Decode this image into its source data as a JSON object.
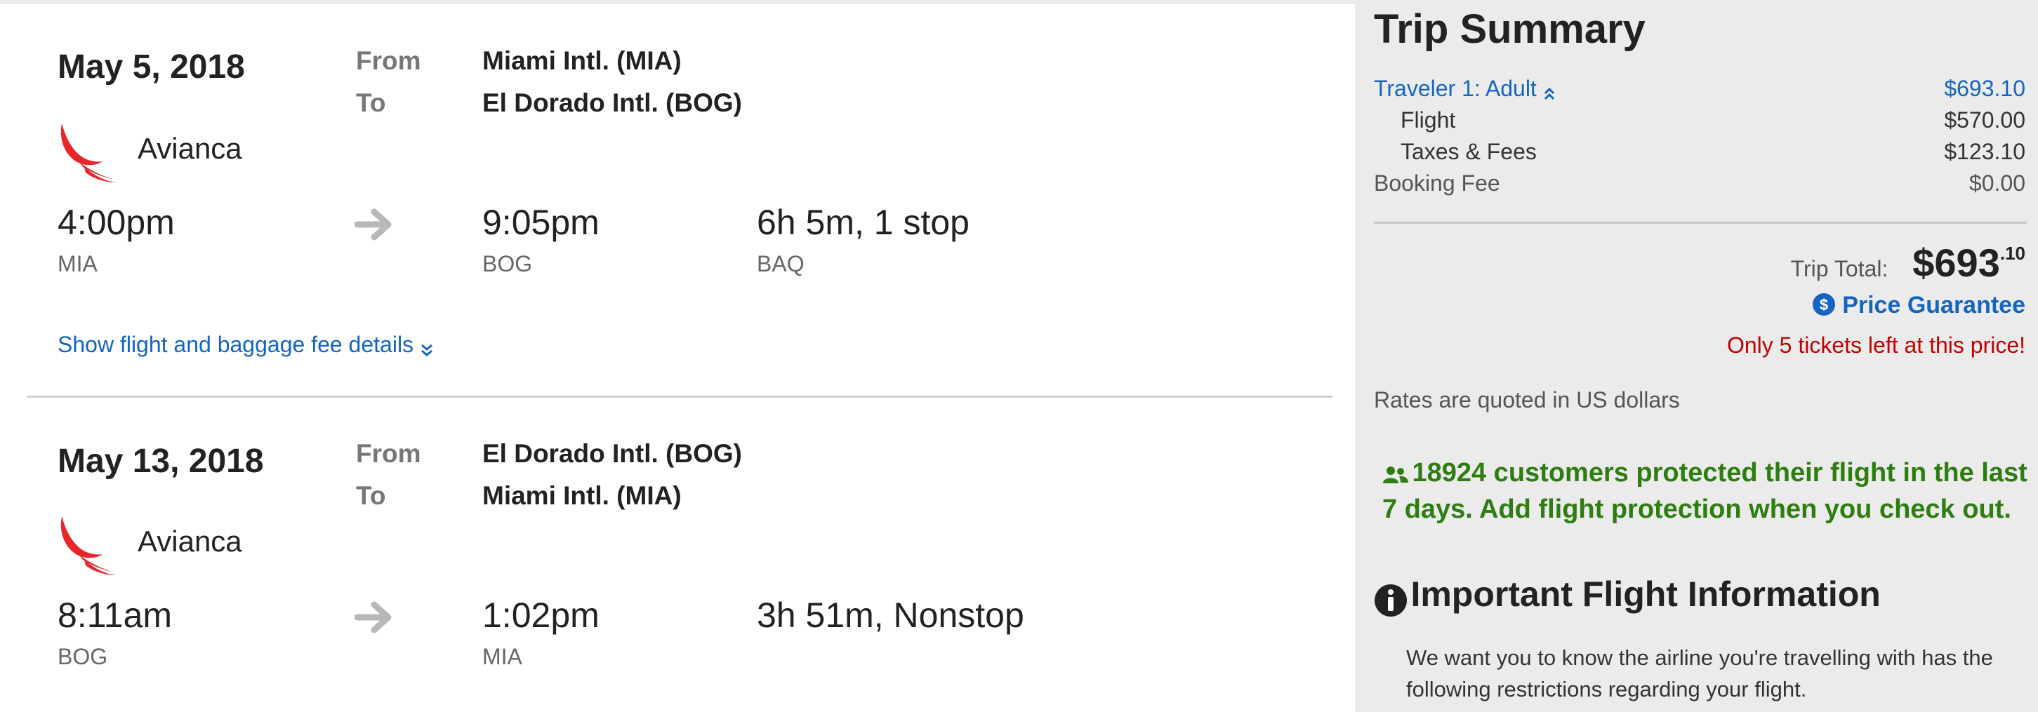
{
  "flights": [
    {
      "date": "May 5, 2018",
      "from_label": "From",
      "from_airport": "Miami Intl. (MIA)",
      "to_label": "To",
      "to_airport": "El Dorado Intl. (BOG)",
      "airline": "Avianca",
      "depart_time": "4:00pm",
      "depart_code": "MIA",
      "arrive_time": "9:05pm",
      "arrive_code": "BOG",
      "duration": "6h 5m, 1 stop",
      "stop_code": "BAQ",
      "details_link": "Show flight and baggage fee details"
    },
    {
      "date": "May 13, 2018",
      "from_label": "From",
      "from_airport": "El Dorado Intl. (BOG)",
      "to_label": "To",
      "to_airport": "Miami Intl. (MIA)",
      "airline": "Avianca",
      "depart_time": "8:11am",
      "depart_code": "BOG",
      "arrive_time": "1:02pm",
      "arrive_code": "MIA",
      "duration": "3h 51m, Nonstop"
    }
  ],
  "summary": {
    "title": "Trip Summary",
    "traveler_label": "Traveler 1: Adult",
    "traveler_amount": "$693.10",
    "flight_label": "Flight",
    "flight_amount": "$570.00",
    "taxes_label": "Taxes & Fees",
    "taxes_amount": "$123.10",
    "booking_fee_label": "Booking Fee",
    "booking_fee_amount": "$0.00",
    "trip_total_label": "Trip Total:",
    "trip_total_dollars": "$693",
    "trip_total_cents": ".10",
    "price_guarantee": "Price Guarantee",
    "tickets_left": "Only 5 tickets left at this price!",
    "rates_note": "Rates are quoted in US dollars",
    "protection_message": "18924 customers protected their flight in the last 7 days. Add flight protection when you check out.",
    "info_title": "Important Flight Information",
    "info_body": "We want you to know the airline you're travelling with has the following restrictions regarding your flight."
  },
  "icons": {
    "airline_logo": "avianca-logo",
    "arrow": "arrow-right-icon",
    "chevron": "chevron-down-double-icon",
    "chevron_up": "chevron-up-double-icon",
    "guarantee": "dollar-circle-icon",
    "people": "users-icon",
    "info": "info-circle-icon"
  },
  "colors": {
    "link_blue": "#1565c0",
    "alert_red": "#c40000",
    "success_green": "#2e7d10",
    "avianca_red": "#e8262a"
  }
}
